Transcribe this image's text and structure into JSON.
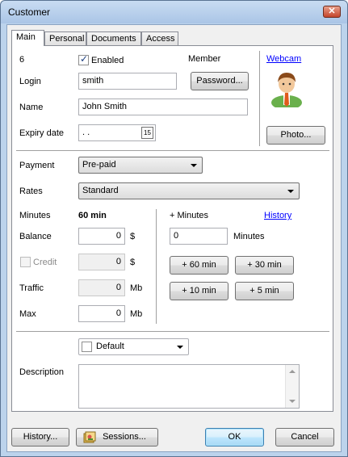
{
  "window": {
    "title": "Customer",
    "close_glyph": "✕"
  },
  "tabs": [
    "Main",
    "Personal",
    "Documents",
    "Access"
  ],
  "main": {
    "id": "6",
    "enabled_label": "Enabled",
    "enabled_checked": true,
    "member_label": "Member",
    "login_label": "Login",
    "login_value": "smith",
    "password_button": "Password...",
    "webcam_link": "Webcam",
    "photo_button": "Photo...",
    "name_label": "Name",
    "name_value": "John Smith",
    "expiry_label": "Expiry date",
    "expiry_value": ". .",
    "calendar_glyph": "15",
    "payment_label": "Payment",
    "payment_value": "Pre-paid",
    "rates_label": "Rates",
    "rates_value": "Standard",
    "minutes_label": "Minutes",
    "minutes_value": "60 min",
    "plus_minutes_label": "+ Minutes",
    "history_link": "History",
    "balance_label": "Balance",
    "balance_value": "0",
    "balance_unit": "$",
    "add_minutes_value": "0",
    "add_minutes_unit": "Minutes",
    "credit_label": "Credit",
    "credit_value": "0",
    "credit_unit": "$",
    "traffic_label": "Traffic",
    "traffic_value": "0",
    "traffic_unit": "Mb",
    "max_label": "Max",
    "max_value": "0",
    "max_unit": "Mb",
    "btn_60": "+ 60 min",
    "btn_30": "+ 30 min",
    "btn_10": "+ 10 min",
    "btn_5": "+ 5 min",
    "group_value": "Default",
    "description_label": "Description",
    "description_value": ""
  },
  "footer": {
    "history_button": "History...",
    "sessions_button": "Sessions...",
    "ok_button": "OK",
    "cancel_button": "Cancel"
  },
  "colors": {
    "accent_link": "#0000ff",
    "window_frame": "#bcd3ec"
  },
  "icons": [
    "close-icon",
    "calendar-icon",
    "avatar-icon",
    "sessions-icon",
    "chevron-down-icon"
  ]
}
